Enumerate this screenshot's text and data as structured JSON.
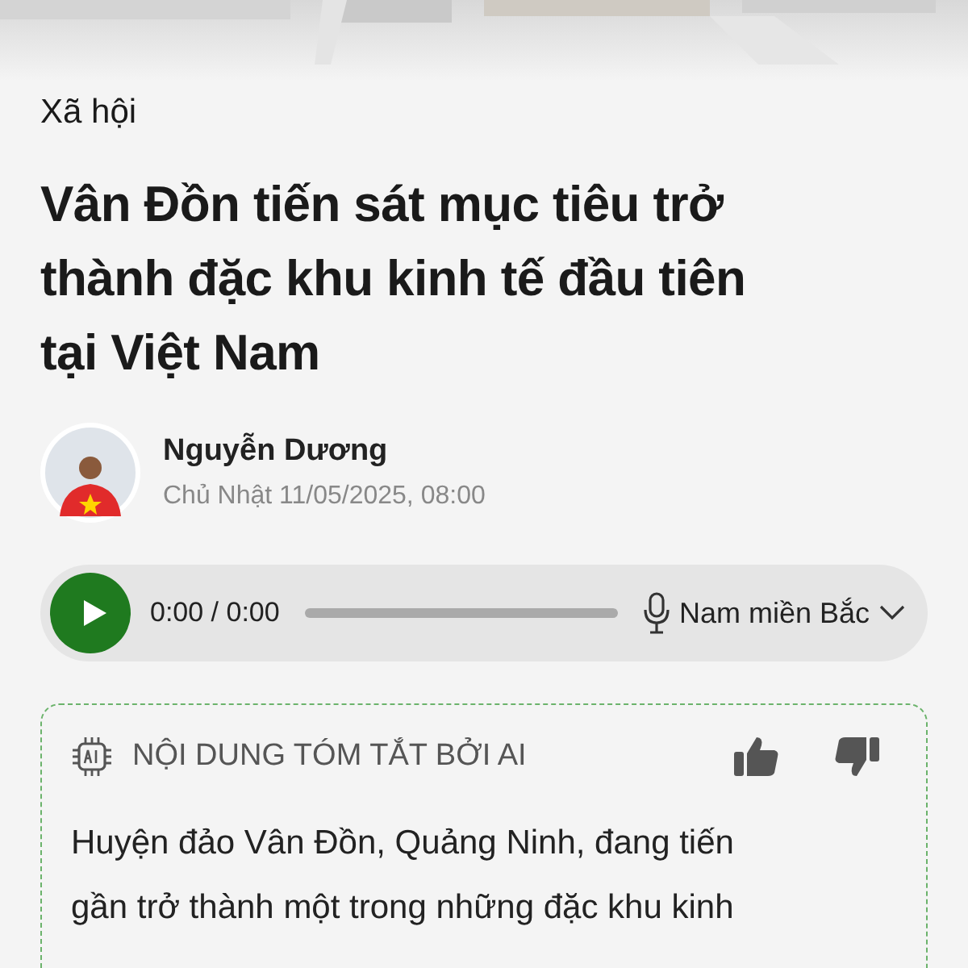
{
  "category": "Xã hội",
  "title_lines": [
    "Vân Đồn tiến sát mục tiêu trở",
    "thành đặc khu kinh tế đầu tiên",
    "tại Việt Nam"
  ],
  "author": {
    "name": "Nguyễn Dương",
    "date": "Chủ Nhật 11/05/2025, 08:00"
  },
  "audio_player": {
    "time": "0:00 / 0:00",
    "voice": "Nam miền Bắc"
  },
  "ai_summary": {
    "heading": "NỘI DUNG TÓM TẮT BỞI AI",
    "text_lines": [
      "Huyện đảo Vân Đồn, Quảng Ninh, đang tiến",
      "gần trở thành một trong những đặc khu kinh"
    ]
  }
}
